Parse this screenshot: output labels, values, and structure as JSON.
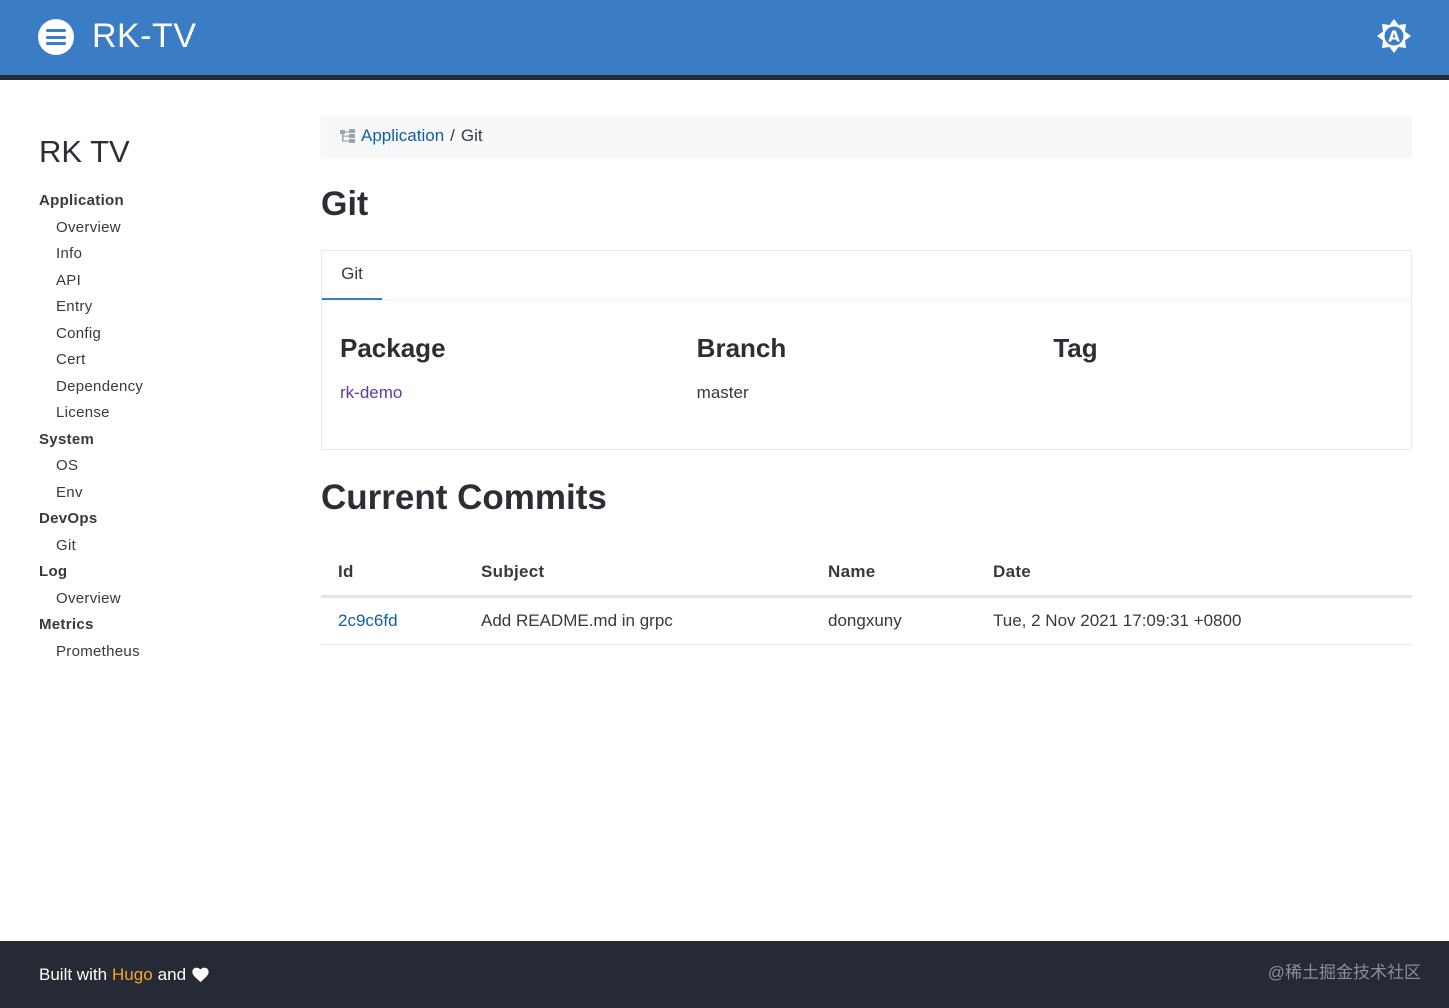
{
  "header": {
    "brand": "RK-TV",
    "menu_icon": "menu-icon",
    "theme_icon": "theme-auto-icon",
    "theme_letter": "A",
    "color": "#3b7dc4"
  },
  "sidebar": {
    "title": "RK TV",
    "sections": [
      {
        "label": "Application",
        "items": [
          "Overview",
          "Info",
          "API",
          "Entry",
          "Config",
          "Cert",
          "Dependency",
          "License"
        ]
      },
      {
        "label": "System",
        "items": [
          "OS",
          "Env"
        ]
      },
      {
        "label": "DevOps",
        "items": [
          "Git"
        ]
      },
      {
        "label": "Log",
        "items": [
          "Overview"
        ]
      },
      {
        "label": "Metrics",
        "items": [
          "Prometheus"
        ]
      }
    ]
  },
  "breadcrumb": {
    "icon": "sitemap-icon",
    "parent": "Application",
    "separator": "/",
    "current": "Git"
  },
  "page": {
    "title": "Git"
  },
  "tabs": {
    "active": "Git",
    "columns": [
      {
        "heading": "Package",
        "value": "rk-demo",
        "is_link": true
      },
      {
        "heading": "Branch",
        "value": "master",
        "is_link": false
      },
      {
        "heading": "Tag",
        "value": "",
        "is_link": false
      }
    ]
  },
  "commits": {
    "title": "Current Commits",
    "headers": [
      "Id",
      "Subject",
      "Name",
      "Date"
    ],
    "rows": [
      {
        "id": "2c9c6fd",
        "subject": "Add README.md in grpc",
        "name": "dongxuny",
        "date": "Tue, 2 Nov 2021 17:09:31 +0800"
      }
    ]
  },
  "footer": {
    "built_with": "Built with",
    "hugo": "Hugo",
    "and": "and",
    "heart_icon": "heart-icon",
    "watermark": "@稀土掘金技术社区"
  }
}
